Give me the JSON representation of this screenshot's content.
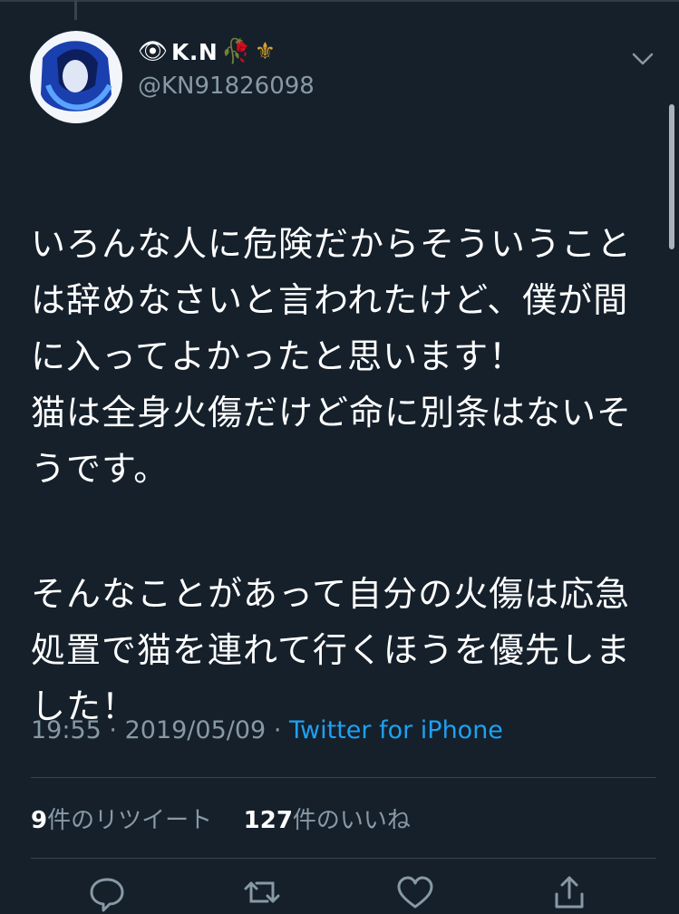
{
  "tweet": {
    "display_name_emojis": [
      "👁",
      "🥀",
      "⚜"
    ],
    "display_name": "K.N",
    "handle": "@KN91826098",
    "text": "いろんな人に危険だからそういうことは辞めなさいと言われたけど、僕が間に入ってよかったと思います！\n猫は全身火傷だけど命に別条はないそうです。",
    "text2": "そんなことがあって自分の火傷は応急処置で猫を連れて行くほうを優先しました！",
    "time": "19:55",
    "date": "2019/05/09",
    "separator": "·",
    "source": "Twitter for iPhone",
    "retweet_count": "9",
    "retweet_label": "件のリツイート",
    "like_count": "127",
    "like_label": "件のいいね"
  },
  "icons": {
    "menu": "chevron-down-icon",
    "reply": "reply-icon",
    "retweet": "retweet-icon",
    "like": "like-icon",
    "share": "share-icon"
  },
  "colors": {
    "background": "#15202b",
    "text": "#ffffff",
    "secondary": "#8899a6",
    "link": "#1da1f2",
    "divider": "#38444d"
  }
}
